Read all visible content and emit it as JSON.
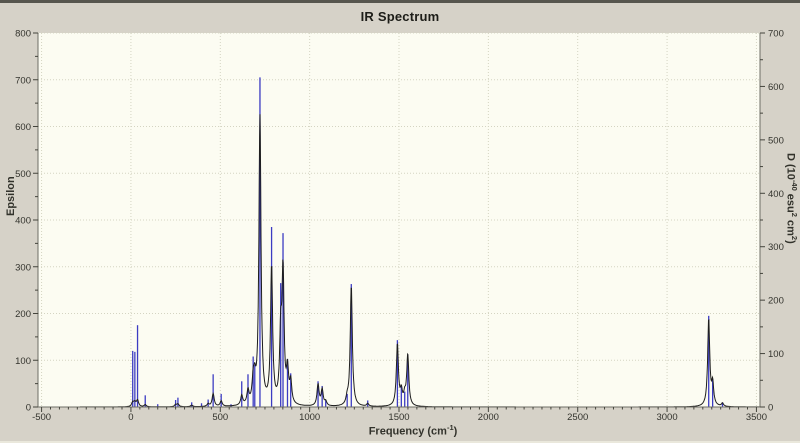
{
  "window": {
    "title": "IR Spectrum"
  },
  "axes": {
    "ylabel_left": "Epsilon",
    "xlabel": {
      "s1": "Frequency (cm",
      "sup1": "-1",
      "s2": ")"
    },
    "ylabel_right": {
      "s1": "D (10",
      "sup1": "-40",
      "s2": " esu",
      "sup2": "2",
      "s3": " cm",
      "sup3": "2",
      "s4": ")"
    }
  },
  "colors": {
    "window_bg": "#d6d2c8",
    "plot_bg": "#fcfcf2",
    "grid": "#d4d4c2",
    "frame": "#6e6e66",
    "tick": "#44443c",
    "tick_text": "#33332d",
    "stick_blue": "#3b3bc2",
    "envelope_black": "#1e1e1e"
  },
  "chart_data": {
    "type": "line",
    "subtype": "IR stick spectrum (epsilon) with Lorentzian-broadened intensity curve (D)",
    "title": "IR Spectrum",
    "xlabel": "Frequency (cm^-1)",
    "ylabel_left": "Epsilon",
    "ylabel_right": "D (10^-40 esu^2 cm^2)",
    "xlim": [
      -520,
      3520
    ],
    "ylim_left": [
      0,
      800
    ],
    "ylim_right": [
      0,
      700
    ],
    "x_major_ticks": [
      -500,
      0,
      500,
      1000,
      1500,
      2000,
      2500,
      3000,
      3500
    ],
    "x_minor_step": 50,
    "y_left_major_ticks": [
      0,
      100,
      200,
      300,
      400,
      500,
      600,
      700,
      800
    ],
    "y_right_major_ticks": [
      0,
      100,
      200,
      300,
      400,
      500,
      600,
      700
    ],
    "y_minor_step": 50,
    "grid": {
      "show": true,
      "style": "dotted",
      "on_x_majors": true,
      "on_y_left_majors": true
    },
    "legend": null,
    "series": [
      {
        "name": "stick spectrum (Epsilon, left axis)",
        "type": "sticks",
        "axis": "left",
        "color": "#3b3bc2",
        "points": [
          [
            10,
            120
          ],
          [
            22,
            118
          ],
          [
            37,
            175
          ],
          [
            80,
            25
          ],
          [
            150,
            6
          ],
          [
            250,
            15
          ],
          [
            263,
            20
          ],
          [
            340,
            10
          ],
          [
            395,
            8
          ],
          [
            432,
            16
          ],
          [
            460,
            70
          ],
          [
            505,
            28
          ],
          [
            560,
            6
          ],
          [
            620,
            55
          ],
          [
            655,
            70
          ],
          [
            684,
            108
          ],
          [
            693,
            90
          ],
          [
            722,
            705
          ],
          [
            787,
            385
          ],
          [
            838,
            265
          ],
          [
            851,
            372
          ],
          [
            876,
            103
          ],
          [
            894,
            72
          ],
          [
            1047,
            55
          ],
          [
            1070,
            45
          ],
          [
            1090,
            15
          ],
          [
            1210,
            28
          ],
          [
            1233,
            263
          ],
          [
            1325,
            14
          ],
          [
            1491,
            143
          ],
          [
            1513,
            45
          ],
          [
            1532,
            33
          ],
          [
            1549,
            112
          ],
          [
            3233,
            195
          ],
          [
            3255,
            60
          ],
          [
            3310,
            10
          ]
        ]
      },
      {
        "name": "broadened curve (D, right axis)",
        "type": "lorentzian_sum",
        "axis": "right",
        "color": "#1e1e1e",
        "hwhm": 7,
        "peaks": [
          [
            10,
            8
          ],
          [
            22,
            8
          ],
          [
            37,
            12
          ],
          [
            80,
            4
          ],
          [
            250,
            4
          ],
          [
            263,
            5
          ],
          [
            340,
            3
          ],
          [
            432,
            5
          ],
          [
            460,
            24
          ],
          [
            505,
            10
          ],
          [
            620,
            18
          ],
          [
            655,
            25
          ],
          [
            684,
            40
          ],
          [
            693,
            35
          ],
          [
            722,
            540
          ],
          [
            787,
            255
          ],
          [
            838,
            120
          ],
          [
            851,
            240
          ],
          [
            876,
            60
          ],
          [
            894,
            40
          ],
          [
            1047,
            40
          ],
          [
            1070,
            30
          ],
          [
            1090,
            8
          ],
          [
            1210,
            12
          ],
          [
            1233,
            225
          ],
          [
            1325,
            5
          ],
          [
            1491,
            115
          ],
          [
            1513,
            25
          ],
          [
            1532,
            18
          ],
          [
            1549,
            95
          ],
          [
            3233,
            162
          ],
          [
            3255,
            40
          ],
          [
            3310,
            6
          ]
        ]
      }
    ]
  }
}
